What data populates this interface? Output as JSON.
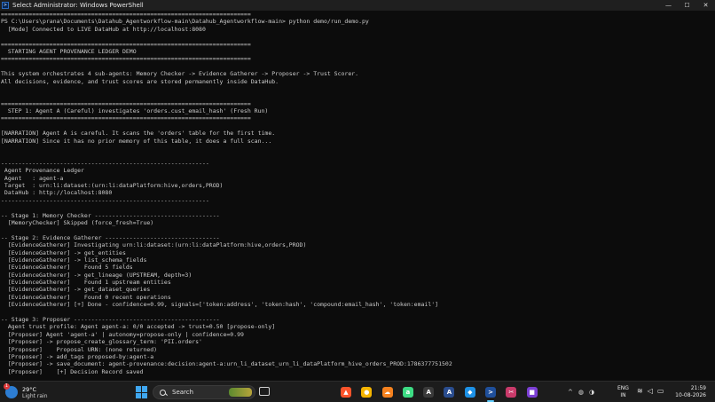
{
  "window": {
    "title": "Select Administrator: Windows PowerShell",
    "controls": {
      "minimize": "—",
      "maximize": "☐",
      "close": "✕"
    }
  },
  "console_lines": [
    "========================================================================",
    "PS C:\\Users\\prana\\Documents\\Datahub_Agentworkflow-main\\Datahub_Agentworkflow-main> python demo/run_demo.py",
    "  [Mode] Connected to LIVE DataHub at http://localhost:8080",
    "",
    "========================================================================",
    "  STARTING AGENT PROVENANCE LEDGER DEMO",
    "========================================================================",
    "",
    "This system orchestrates 4 sub-agents: Memory Checker -> Evidence Gatherer -> Proposer -> Trust Scorer.",
    "All decisions, evidence, and trust scores are stored permanently inside DataHub.",
    "",
    "",
    "========================================================================",
    "  STEP 1: Agent A (Careful) investigates 'orders.cust_email_hash' (Fresh Run)",
    "========================================================================",
    "",
    "[NARRATION] Agent A is careful. It scans the 'orders' table for the first time.",
    "[NARRATION] Since it has no prior memory of this table, it does a full scan...",
    "",
    "",
    "------------------------------------------------------------",
    " Agent Provenance Ledger",
    " Agent   : agent-a",
    " Target  : urn:li:dataset:(urn:li:dataPlatform:hive,orders,PROD)",
    " DataHub : http://localhost:8080",
    "------------------------------------------------------------",
    "",
    "-- Stage 1: Memory Checker ------------------------------------",
    "  [MemoryChecker] Skipped (force_fresh=True)",
    "",
    "-- Stage 2: Evidence Gatherer ---------------------------------",
    "  [EvidenceGatherer] Investigating urn:li:dataset:(urn:li:dataPlatform:hive,orders,PROD)",
    "  [EvidenceGatherer] -> get_entities",
    "  [EvidenceGatherer] -> list_schema_fields",
    "  [EvidenceGatherer]    Found 5 fields",
    "  [EvidenceGatherer] -> get_lineage (UPSTREAM, depth=3)",
    "  [EvidenceGatherer]    Found 1 upstream entities",
    "  [EvidenceGatherer] -> get_dataset_queries",
    "  [EvidenceGatherer]    Found 0 recent operations",
    "  [EvidenceGatherer] [+] Done - confidence=0.99, signals=['token:address', 'token:hash', 'compound:email_hash', 'token:email']",
    "",
    "-- Stage 3: Proposer ------------------------------------------",
    "  Agent trust profile: Agent agent-a: 0/0 accepted -> trust=0.50 [propose-only]",
    "  [Proposer] Agent 'agent-a' | autonomy=propose-only | confidence=0.99",
    "  [Proposer] -> propose_create_glossary_term: 'PII.orders'",
    "  [Proposer]    Proposal URN: (none returned)",
    "  [Proposer] -> add_tags proposed-by:agent-a",
    "  [Proposer] -> save_document: agent-provenance:decision:agent-a:urn_li_dataset_urn_li_dataPlatform_hive_orders_PROD:1786377751502",
    "  [Proposer]    [+] Decision Record saved"
  ],
  "taskbar": {
    "weather": {
      "badge": "1",
      "temp": "29°C",
      "condition": "Light rain"
    },
    "search_placeholder": "Search",
    "apps": [
      {
        "icon": "brave-browser-icon",
        "glyph": "▲",
        "color": "#fb542b"
      },
      {
        "icon": "chrome-icon",
        "glyph": "●",
        "color": "#f4b400"
      },
      {
        "icon": "cloud-app-icon",
        "glyph": "☁",
        "color": "#f6821f"
      },
      {
        "icon": "android-studio-icon",
        "glyph": "a",
        "color": "#3ddc84"
      },
      {
        "icon": "ai-app-icon",
        "glyph": "A",
        "color": "#3a3a3a"
      },
      {
        "icon": "arc-app-icon",
        "glyph": "A",
        "color": "#2a4d8f"
      },
      {
        "icon": "docker-icon",
        "glyph": "◆",
        "color": "#1d91e6"
      },
      {
        "icon": "powershell-icon",
        "glyph": ">",
        "color": "#1f4f9a"
      },
      {
        "icon": "snipping-tool-icon",
        "glyph": "✂",
        "color": "#c93a6a"
      },
      {
        "icon": "purple-app-icon",
        "glyph": "■",
        "color": "#7b3fd4"
      }
    ],
    "tray": {
      "chevron": "^",
      "icons": [
        "◍",
        "◑"
      ]
    },
    "language": {
      "line1": "ENG",
      "line2": "IN"
    },
    "system_icons": [
      "≋",
      "◁",
      "▭"
    ],
    "time": "21:59",
    "date": "10-08-2026"
  }
}
